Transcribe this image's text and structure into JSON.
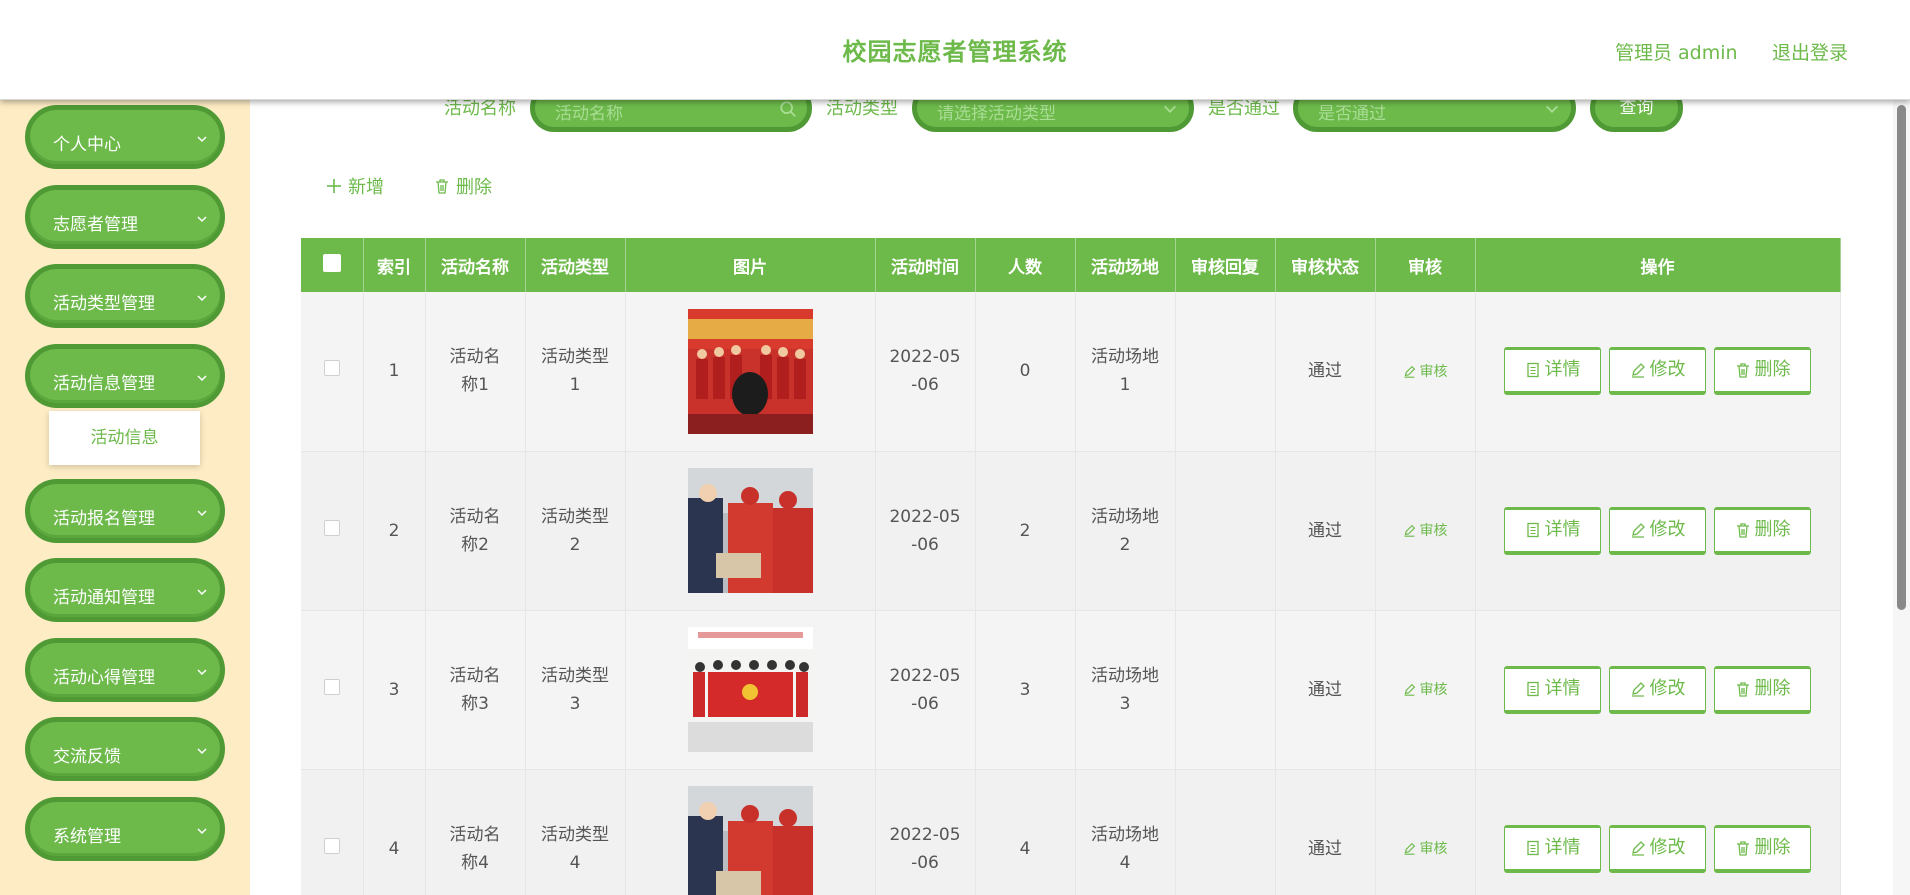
{
  "header": {
    "title": "校园志愿者管理系统",
    "user": "管理员 admin",
    "logout": "退出登录"
  },
  "sidebar": {
    "items": [
      {
        "label": "个人中心"
      },
      {
        "label": "志愿者管理"
      },
      {
        "label": "活动类型管理"
      },
      {
        "label": "活动信息管理"
      },
      {
        "label": "活动报名管理"
      },
      {
        "label": "活动通知管理"
      },
      {
        "label": "活动心得管理"
      },
      {
        "label": "交流反馈"
      },
      {
        "label": "系统管理"
      }
    ],
    "submenu": {
      "label": "活动信息"
    }
  },
  "filters": {
    "name_label": "活动名称",
    "name_placeholder": "活动名称",
    "type_label": "活动类型",
    "type_placeholder": "请选择活动类型",
    "passed_label": "是否通过",
    "passed_placeholder": "是否通过",
    "query_button": "查询"
  },
  "toolbar": {
    "add": "新增",
    "delete": "删除"
  },
  "table": {
    "columns": [
      "索引",
      "活动名称",
      "活动类型",
      "图片",
      "活动时间",
      "人数",
      "活动场地",
      "审核回复",
      "审核状态",
      "审核",
      "操作"
    ],
    "rows": [
      {
        "index": "1",
        "name": "活动名称1",
        "type": "活动类型1",
        "time": "2022-05-06",
        "count": "0",
        "venue": "活动场地1",
        "reply": "",
        "status": "通过",
        "image": "volunteers-banner-photo"
      },
      {
        "index": "2",
        "name": "活动名称2",
        "type": "活动类型2",
        "time": "2022-05-06",
        "count": "2",
        "venue": "活动场地2",
        "reply": "",
        "status": "通过",
        "image": "volunteers-handing-items-photo"
      },
      {
        "index": "3",
        "name": "活动名称3",
        "type": "活动类型3",
        "time": "2022-05-06",
        "count": "3",
        "venue": "活动场地3",
        "reply": "",
        "status": "通过",
        "image": "volunteers-group-photo"
      },
      {
        "index": "4",
        "name": "活动名称4",
        "type": "活动类型4",
        "time": "2022-05-06",
        "count": "4",
        "venue": "活动场地4",
        "reply": "",
        "status": "通过",
        "image": "volunteers-handing-items-photo"
      }
    ],
    "audit_label": "审核",
    "detail_label": "详情",
    "edit_label": "修改",
    "delete_label": "删除"
  },
  "colors": {
    "accent": "#6dba4b",
    "accent_dark": "#4f9a35",
    "sidebar_bg": "#fdecc4"
  }
}
